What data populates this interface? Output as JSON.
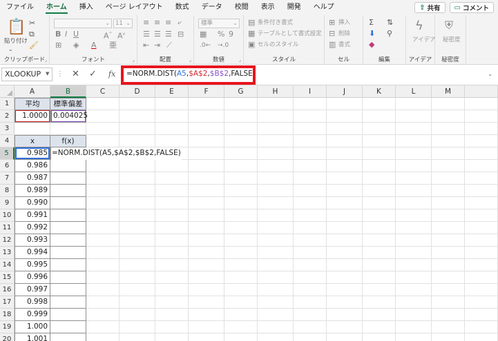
{
  "menu": {
    "tabs": [
      "ファイル",
      "ホーム",
      "挿入",
      "ページ レイアウト",
      "数式",
      "データ",
      "校閲",
      "表示",
      "開発",
      "ヘルプ"
    ],
    "active_tab": "ホーム",
    "share_label": "共有",
    "comment_label": "コメント"
  },
  "ribbon": {
    "clipboard": {
      "label": "クリップボード",
      "paste_label": "貼り付け"
    },
    "font": {
      "label": "フォント",
      "size_value": "11"
    },
    "alignment": {
      "label": "配置"
    },
    "number": {
      "label": "数値",
      "format_value": "標準"
    },
    "styles": {
      "label": "スタイル",
      "conditional": "条件付き書式",
      "table": "テーブルとして書式設定",
      "cell_styles": "セルのスタイル"
    },
    "cells": {
      "label": "セル",
      "insert": "挿入",
      "delete": "削除",
      "format": "書式"
    },
    "editing": {
      "label": "編集"
    },
    "ideas": {
      "label": "アイデア",
      "button": "アイデア"
    },
    "sensitivity": {
      "label": "秘密度",
      "button": "秘密度"
    }
  },
  "formula_bar": {
    "name_box": "XLOOKUP",
    "fx": "fx",
    "parts": {
      "prefix": "=NORM.DIST(",
      "arg1": "A5",
      "sep1": ",",
      "arg2": "$A$2",
      "sep2": ",",
      "arg3": "$B$2",
      "suffix": ",FALSE)"
    }
  },
  "sheet": {
    "columns": [
      "A",
      "B",
      "C",
      "D",
      "E",
      "F",
      "G",
      "H",
      "I",
      "J",
      "K",
      "L",
      "M"
    ],
    "rows": [
      "1",
      "2",
      "3",
      "4",
      "5",
      "6",
      "7",
      "8",
      "9",
      "10",
      "11",
      "12",
      "13",
      "14",
      "15",
      "16",
      "17",
      "18",
      "19",
      "20"
    ],
    "A1": "平均",
    "B1": "標準偏差",
    "A2": "1.0000",
    "B2": "0.004025",
    "A4": "x",
    "B4": "f(x)",
    "B5": "=NORM.DIST(A5,$A$2,$B$2,FALSE)",
    "x_values": [
      "0.985",
      "0.986",
      "0.987",
      "0.989",
      "0.990",
      "0.991",
      "0.992",
      "0.993",
      "0.994",
      "0.995",
      "0.996",
      "0.997",
      "0.998",
      "0.999",
      "1.000",
      "1.001"
    ]
  },
  "colors": {
    "excel_green": "#107c41",
    "highlight_red": "#e8141e",
    "ref_blue": "#2e6fd8",
    "ref_red": "#d6282e",
    "ref_purple": "#8a4fc8",
    "header_fill": "#dde3ec"
  }
}
